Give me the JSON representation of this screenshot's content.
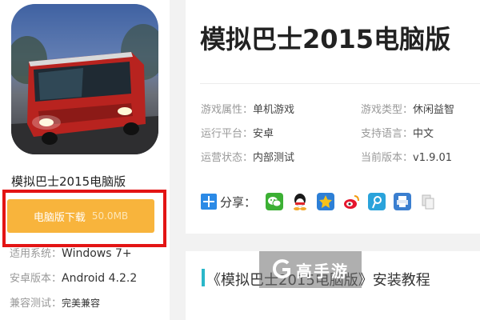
{
  "app": {
    "name": "模拟巴士2015电脑版",
    "title": "模拟巴士2015电脑版",
    "icon": "bus-app-icon"
  },
  "download": {
    "label": "电脑版下载",
    "size": "50.0MB"
  },
  "specs": [
    {
      "key": "适用系统",
      "sep": "：",
      "value": "Windows 7+"
    },
    {
      "key": "安卓版本",
      "sep": "：",
      "value": "Android 4.2.2"
    },
    {
      "key": "兼容测试",
      "sep": "：",
      "value": "完美兼容"
    }
  ],
  "attributes": [
    {
      "key": "游戏属性",
      "sep": "：",
      "value": "单机游戏"
    },
    {
      "key": "游戏类型",
      "sep": "：",
      "value": "休闲益智"
    },
    {
      "key": "运行平台",
      "sep": "：",
      "value": "安卓"
    },
    {
      "key": "支持语言",
      "sep": "：",
      "value": "中文"
    },
    {
      "key": "运营状态",
      "sep": "：",
      "value": "内部测试"
    },
    {
      "key": "当前版本",
      "sep": "：",
      "value": "v1.9.01"
    }
  ],
  "share": {
    "label": "分享：",
    "targets": [
      "wechat-icon",
      "qq-icon",
      "qzone-icon",
      "weibo-icon",
      "tencent-weibo-icon",
      "print-icon",
      "copy-icon"
    ]
  },
  "section": {
    "title": "《模拟巴士2015电脑版》安装教程"
  },
  "watermark": {
    "text": "高手游"
  },
  "colors": {
    "download_button": "#f8b43c",
    "highlight_border": "#e31414",
    "accent": "#2ab7c9",
    "share_plus": "#2b8ae6"
  }
}
